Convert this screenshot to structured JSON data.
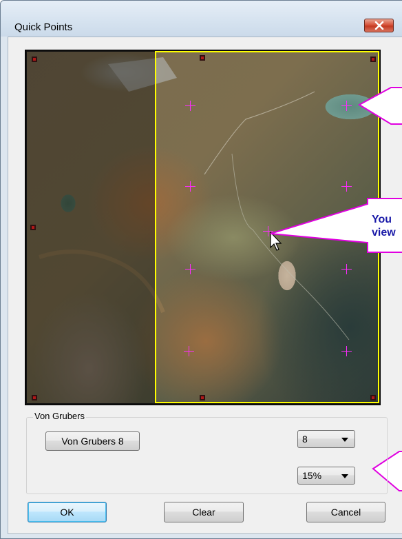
{
  "window": {
    "title": "Quick Points"
  },
  "image_view": {
    "callouts": [
      {
        "text": ""
      },
      {
        "text": "You\nview"
      },
      {
        "text": ""
      }
    ]
  },
  "group": {
    "label": "Von Grubers",
    "pattern_button": "Von Grubers 8",
    "count_select": {
      "value": "8"
    },
    "percent_select": {
      "value": "15%"
    }
  },
  "buttons": {
    "ok": "OK",
    "clear": "Clear",
    "cancel": "Cancel"
  },
  "colors": {
    "marker": "#ff2bff",
    "selection": "#ffff00",
    "callout_border": "#e000e0"
  }
}
